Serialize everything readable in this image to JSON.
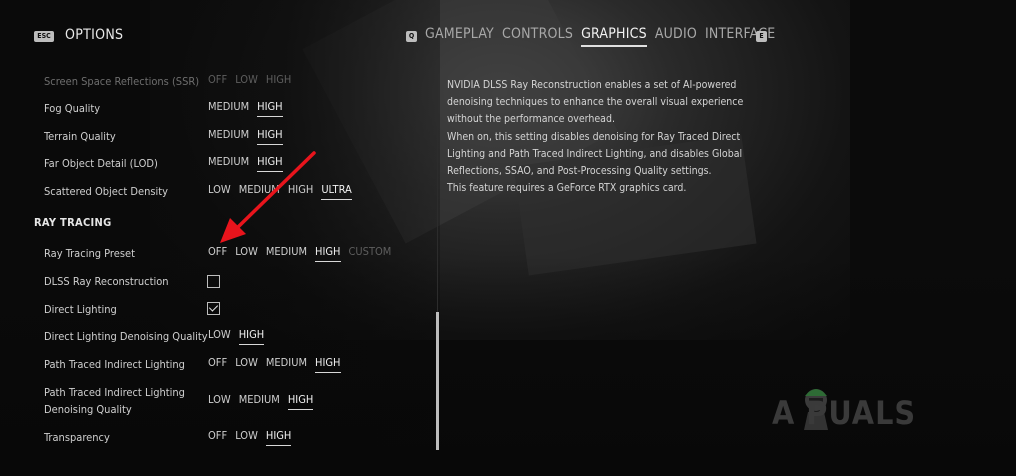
{
  "header": {
    "esc_key": "ESC",
    "title": "OPTIONS",
    "prev_key": "Q",
    "next_key": "E",
    "tabs": [
      {
        "label": "GAMEPLAY"
      },
      {
        "label": "CONTROLS"
      },
      {
        "label": "GRAPHICS",
        "active": true
      },
      {
        "label": "AUDIO"
      },
      {
        "label": "INTERFACE"
      }
    ]
  },
  "settings": {
    "ssr": {
      "label": "Screen Space Reflections (SSR)",
      "options": [
        "OFF",
        "LOW",
        "HIGH"
      ]
    },
    "fog": {
      "label": "Fog Quality",
      "options": [
        "MEDIUM",
        "HIGH"
      ],
      "selected": "HIGH"
    },
    "terrain": {
      "label": "Terrain Quality",
      "options": [
        "MEDIUM",
        "HIGH"
      ],
      "selected": "HIGH"
    },
    "lod": {
      "label": "Far Object Detail (LOD)",
      "options": [
        "MEDIUM",
        "HIGH"
      ],
      "selected": "HIGH"
    },
    "scattered": {
      "label": "Scattered Object Density",
      "options": [
        "LOW",
        "MEDIUM",
        "HIGH",
        "ULTRA"
      ],
      "selected": "ULTRA"
    },
    "ray_tracing_header": "RAY TRACING",
    "rt_preset": {
      "label": "Ray Tracing Preset",
      "options": [
        "OFF",
        "LOW",
        "MEDIUM",
        "HIGH",
        "CUSTOM"
      ],
      "selected": "HIGH"
    },
    "dlss_rr": {
      "label": "DLSS Ray Reconstruction",
      "checked": false
    },
    "direct_lighting": {
      "label": "Direct Lighting",
      "checked": true
    },
    "dl_denoise": {
      "label": "Direct Lighting Denoising Quality",
      "options": [
        "LOW",
        "HIGH"
      ],
      "selected": "HIGH"
    },
    "path_traced": {
      "label": "Path Traced Indirect Lighting",
      "options": [
        "OFF",
        "LOW",
        "MEDIUM",
        "HIGH"
      ],
      "selected": "HIGH"
    },
    "pt_denoise": {
      "label_line1": "Path Traced Indirect Lighting",
      "label_line2": "Denoising Quality",
      "options": [
        "LOW",
        "MEDIUM",
        "HIGH"
      ],
      "selected": "HIGH"
    },
    "transparency": {
      "label": "Transparency",
      "options": [
        "OFF",
        "LOW",
        "HIGH"
      ],
      "selected": "HIGH"
    }
  },
  "description": {
    "p1": "NVIDIA DLSS Ray Reconstruction enables a set of AI-powered denoising techniques to enhance the overall visual experience without the performance overhead.",
    "p2": "When on, this setting disables denoising for Ray Traced Direct Lighting and Path Traced Indirect Lighting, and disables Global Reflections, SSAO, and Post-Processing Quality settings.",
    "p3": "This feature requires a GeForce RTX graphics card."
  },
  "watermark": "A  PUALS",
  "colors": {
    "arrow": "#e8141c",
    "background": "#0b0b0b",
    "text": "#d6d6d6"
  }
}
